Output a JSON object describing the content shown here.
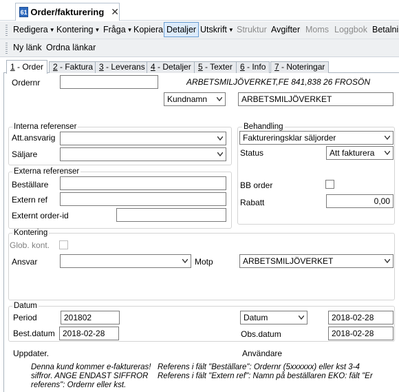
{
  "window": {
    "icon_text": "61",
    "title": "Order/fakturering",
    "close_glyph": "✕"
  },
  "toolbar": {
    "items": [
      {
        "label": "Redigera",
        "dropdown": true,
        "enabled": true
      },
      {
        "label": "Kontering",
        "dropdown": true,
        "enabled": true
      },
      {
        "label": "Fråga",
        "dropdown": true,
        "enabled": true
      },
      {
        "label": "Kopiera",
        "dropdown": false,
        "enabled": true
      },
      {
        "label": "Detaljer",
        "dropdown": false,
        "enabled": true,
        "active": true
      },
      {
        "label": "Utskrift",
        "dropdown": true,
        "enabled": true
      },
      {
        "label": "Struktur",
        "dropdown": false,
        "enabled": false
      },
      {
        "label": "Avgifter",
        "dropdown": false,
        "enabled": true
      },
      {
        "label": "Moms",
        "dropdown": false,
        "enabled": false
      },
      {
        "label": "Loggbok",
        "dropdown": false,
        "enabled": false
      },
      {
        "label": "Betalningar",
        "dropdown": false,
        "enabled": true
      }
    ],
    "links": {
      "new_link": "Ny länk",
      "arrange_links": "Ordna länkar"
    }
  },
  "tabs": [
    {
      "num": "1",
      "label": " - Order",
      "selected": true
    },
    {
      "num": "2",
      "label": " - Faktura",
      "selected": false
    },
    {
      "num": "3",
      "label": " - Leverans",
      "selected": false
    },
    {
      "num": "4",
      "label": " - Detaljer",
      "selected": false
    },
    {
      "num": "5",
      "label": " - Texter",
      "selected": false
    },
    {
      "num": "6",
      "label": " - Info",
      "selected": false
    },
    {
      "num": "7",
      "label": " - Noteringar",
      "selected": false
    }
  ],
  "order": {
    "ordernr_label": "Ordernr",
    "ordernr_value": "",
    "customer_info": "ARBETSMILJÖVERKET,FE 841,838 26 FROSÖN",
    "customer_key_select": "Kundnamn",
    "customer_name": "ARBETSMILJÖVERKET"
  },
  "internal_refs": {
    "title": "Interna referenser",
    "att_label": "Att.ansvarig",
    "att_value": "",
    "seller_label": "Säljare",
    "seller_value": ""
  },
  "external_refs": {
    "title": "Externa referenser",
    "orderer_label": "Beställare",
    "orderer_value": "",
    "extref_label": "Extern ref",
    "extref_value": "",
    "extorder_label": "Externt order-id",
    "extorder_value": ""
  },
  "handling": {
    "title": "Behandling",
    "state_value": "Faktureringsklar säljorder",
    "status_label": "Status",
    "status_value": "Att fakturera",
    "bb_label": "BB order",
    "rabatt_label": "Rabatt",
    "rabatt_value": "0,00"
  },
  "kontering": {
    "title": "Kontering",
    "glob_label": "Glob. kont.",
    "ansvar_label": "Ansvar",
    "ansvar_value": "",
    "motp_label": "Motp",
    "motp_value": "ARBETSMILJÖVERKET"
  },
  "datum": {
    "title": "Datum",
    "period_label": "Period",
    "period_value": "201802",
    "datum_select": "Datum",
    "datum_value": "2018-02-28",
    "best_label": "Best.datum",
    "best_value": "2018-02-28",
    "obs_label": "Obs.datum",
    "obs_value": "2018-02-28"
  },
  "footer": {
    "updated_label": "Uppdater.",
    "user_label": "Användare",
    "note_left": "Denna kund kommer e-faktureras! siffror. ANGE ENDAST SIFFROR referens\": Ordernr eller kst.",
    "note_right": "Referens  i fält \"Beställare\": Ordernr (5xxxxxx)  eller kst 3-4 Referens i fält \"Extern ref\": Namn på beställaren  EKO: fält \"Er"
  }
}
